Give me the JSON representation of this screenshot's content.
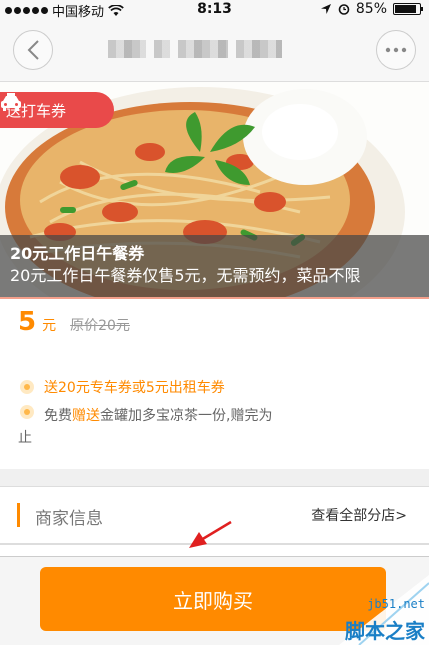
{
  "status_bar": {
    "carrier": "中国移动",
    "time": "8:13",
    "battery": "85%"
  },
  "nav": {
    "back_icon": "chevron-left-icon",
    "more_icon": "ellipsis-icon"
  },
  "hero": {
    "badge_label": "送打车券",
    "badge_icon": "taxi-icon",
    "title": "20元工作日午餐券",
    "subtitle": "20元工作日午餐券仅售5元，无需预约，菜品不限"
  },
  "price": {
    "amount": "5",
    "unit": "元",
    "original": "原价20元"
  },
  "perks": {
    "perk1": "送20元专车券或5元出租车券",
    "perk2_prefix": "免费",
    "perk2_highlight": "赠送",
    "perk2_rest": "金罐加多宝凉茶一份,赠完为",
    "perk2_wrap": "止"
  },
  "merchant": {
    "label": "商家信息",
    "link": "查看全部分店>"
  },
  "bottom": {
    "buy_label": "立即购买"
  },
  "watermark": {
    "site": "jb51.net",
    "brand": "脚本之家"
  },
  "colors": {
    "accent": "#ff8a00",
    "badge_red": "#e94a4a",
    "link_blue": "#1a7fc6"
  }
}
